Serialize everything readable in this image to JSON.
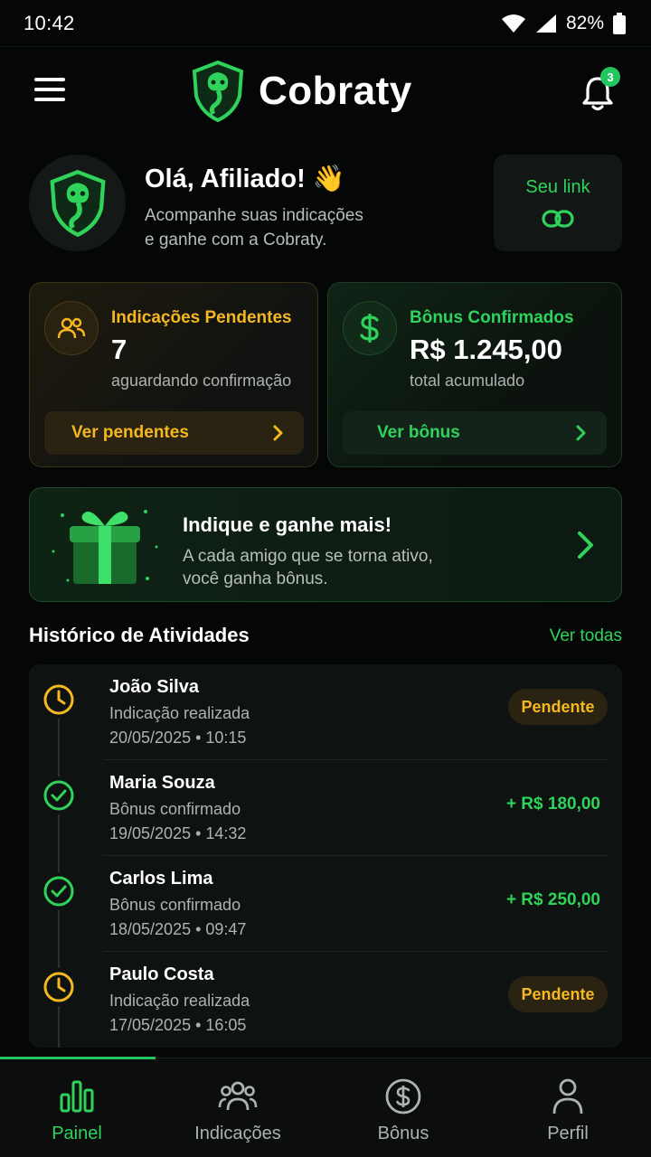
{
  "status_bar": {
    "time": "10:42",
    "battery": "82%"
  },
  "header": {
    "brand": "Cobraty",
    "notification_count": "3"
  },
  "greeting": {
    "title": "Olá, Afiliado! 👋",
    "subtitle_line1": "Acompanhe suas indicações",
    "subtitle_line2": "e ganhe com a Cobraty.",
    "link_label": "Seu link"
  },
  "stats": {
    "pending": {
      "title": "Indicações Pendentes",
      "value": "7",
      "caption": "aguardando confirmação",
      "button": "Ver pendentes"
    },
    "bonus": {
      "title": "Bônus Confirmados",
      "value": "R$ 1.245,00",
      "caption": "total acumulado",
      "button": "Ver bônus"
    }
  },
  "promo": {
    "title": "Indique e ganhe mais!",
    "line1": "A cada amigo que se torna ativo,",
    "line2": "você ganha bônus."
  },
  "history": {
    "title": "Histórico de Atividades",
    "view_all": "Ver todas",
    "items": [
      {
        "name": "João Silva",
        "desc": "Indicação realizada",
        "date": "20/05/2025 • 10:15",
        "status": "pending",
        "badge": "Pendente"
      },
      {
        "name": "Maria Souza",
        "desc": "Bônus confirmado",
        "date": "19/05/2025 • 14:32",
        "status": "confirmed",
        "amount": "+ R$ 180,00"
      },
      {
        "name": "Carlos Lima",
        "desc": "Bônus confirmado",
        "date": "18/05/2025 • 09:47",
        "status": "confirmed",
        "amount": "+ R$ 250,00"
      },
      {
        "name": "Paulo Costa",
        "desc": "Indicação realizada",
        "date": "17/05/2025 • 16:05",
        "status": "pending",
        "badge": "Pendente"
      }
    ]
  },
  "bottom_nav": {
    "items": [
      {
        "label": "Painel",
        "icon": "bar-chart-icon",
        "active": true
      },
      {
        "label": "Indicações",
        "icon": "users-icon",
        "active": false
      },
      {
        "label": "Bônus",
        "icon": "dollar-circle-icon",
        "active": false
      },
      {
        "label": "Perfil",
        "icon": "user-icon",
        "active": false
      }
    ]
  },
  "colors": {
    "accent_green": "#2fd35b",
    "accent_yellow": "#f5b820",
    "background": "#050706"
  }
}
